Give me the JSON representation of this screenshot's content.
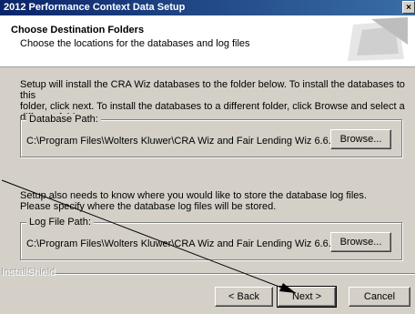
{
  "window": {
    "title": "2012 Performance Context Data Setup",
    "close_glyph": "×"
  },
  "header": {
    "title": "Choose Destination Folders",
    "subtitle": "Choose the locations for the databases and log files"
  },
  "intro": {
    "line1": "Setup will install the CRA Wiz databases to the folder below.  To install the databases to this",
    "line2": "folder, click next.  To install the databases to a different folder, click Browse and select a",
    "line3": "different folder."
  },
  "database_group": {
    "legend": "Database Path:",
    "path": "C:\\Program Files\\Wolters Kluwer\\CRA Wiz and Fair Lending Wiz 6.6...",
    "browse_label": "Browse..."
  },
  "log_intro": {
    "line1": "Setup also needs to know where you would like to store the database log files.",
    "line2": "Please specify where the database log files will be stored."
  },
  "log_group": {
    "legend": "Log File Path:",
    "path": "C:\\Program Files\\Wolters Kluwer\\CRA Wiz and Fair Lending Wiz 6.6...",
    "browse_label": "Browse..."
  },
  "footer": {
    "brand": "InstallShield",
    "back_label": "< Back",
    "next_label": "Next >",
    "cancel_label": "Cancel"
  }
}
